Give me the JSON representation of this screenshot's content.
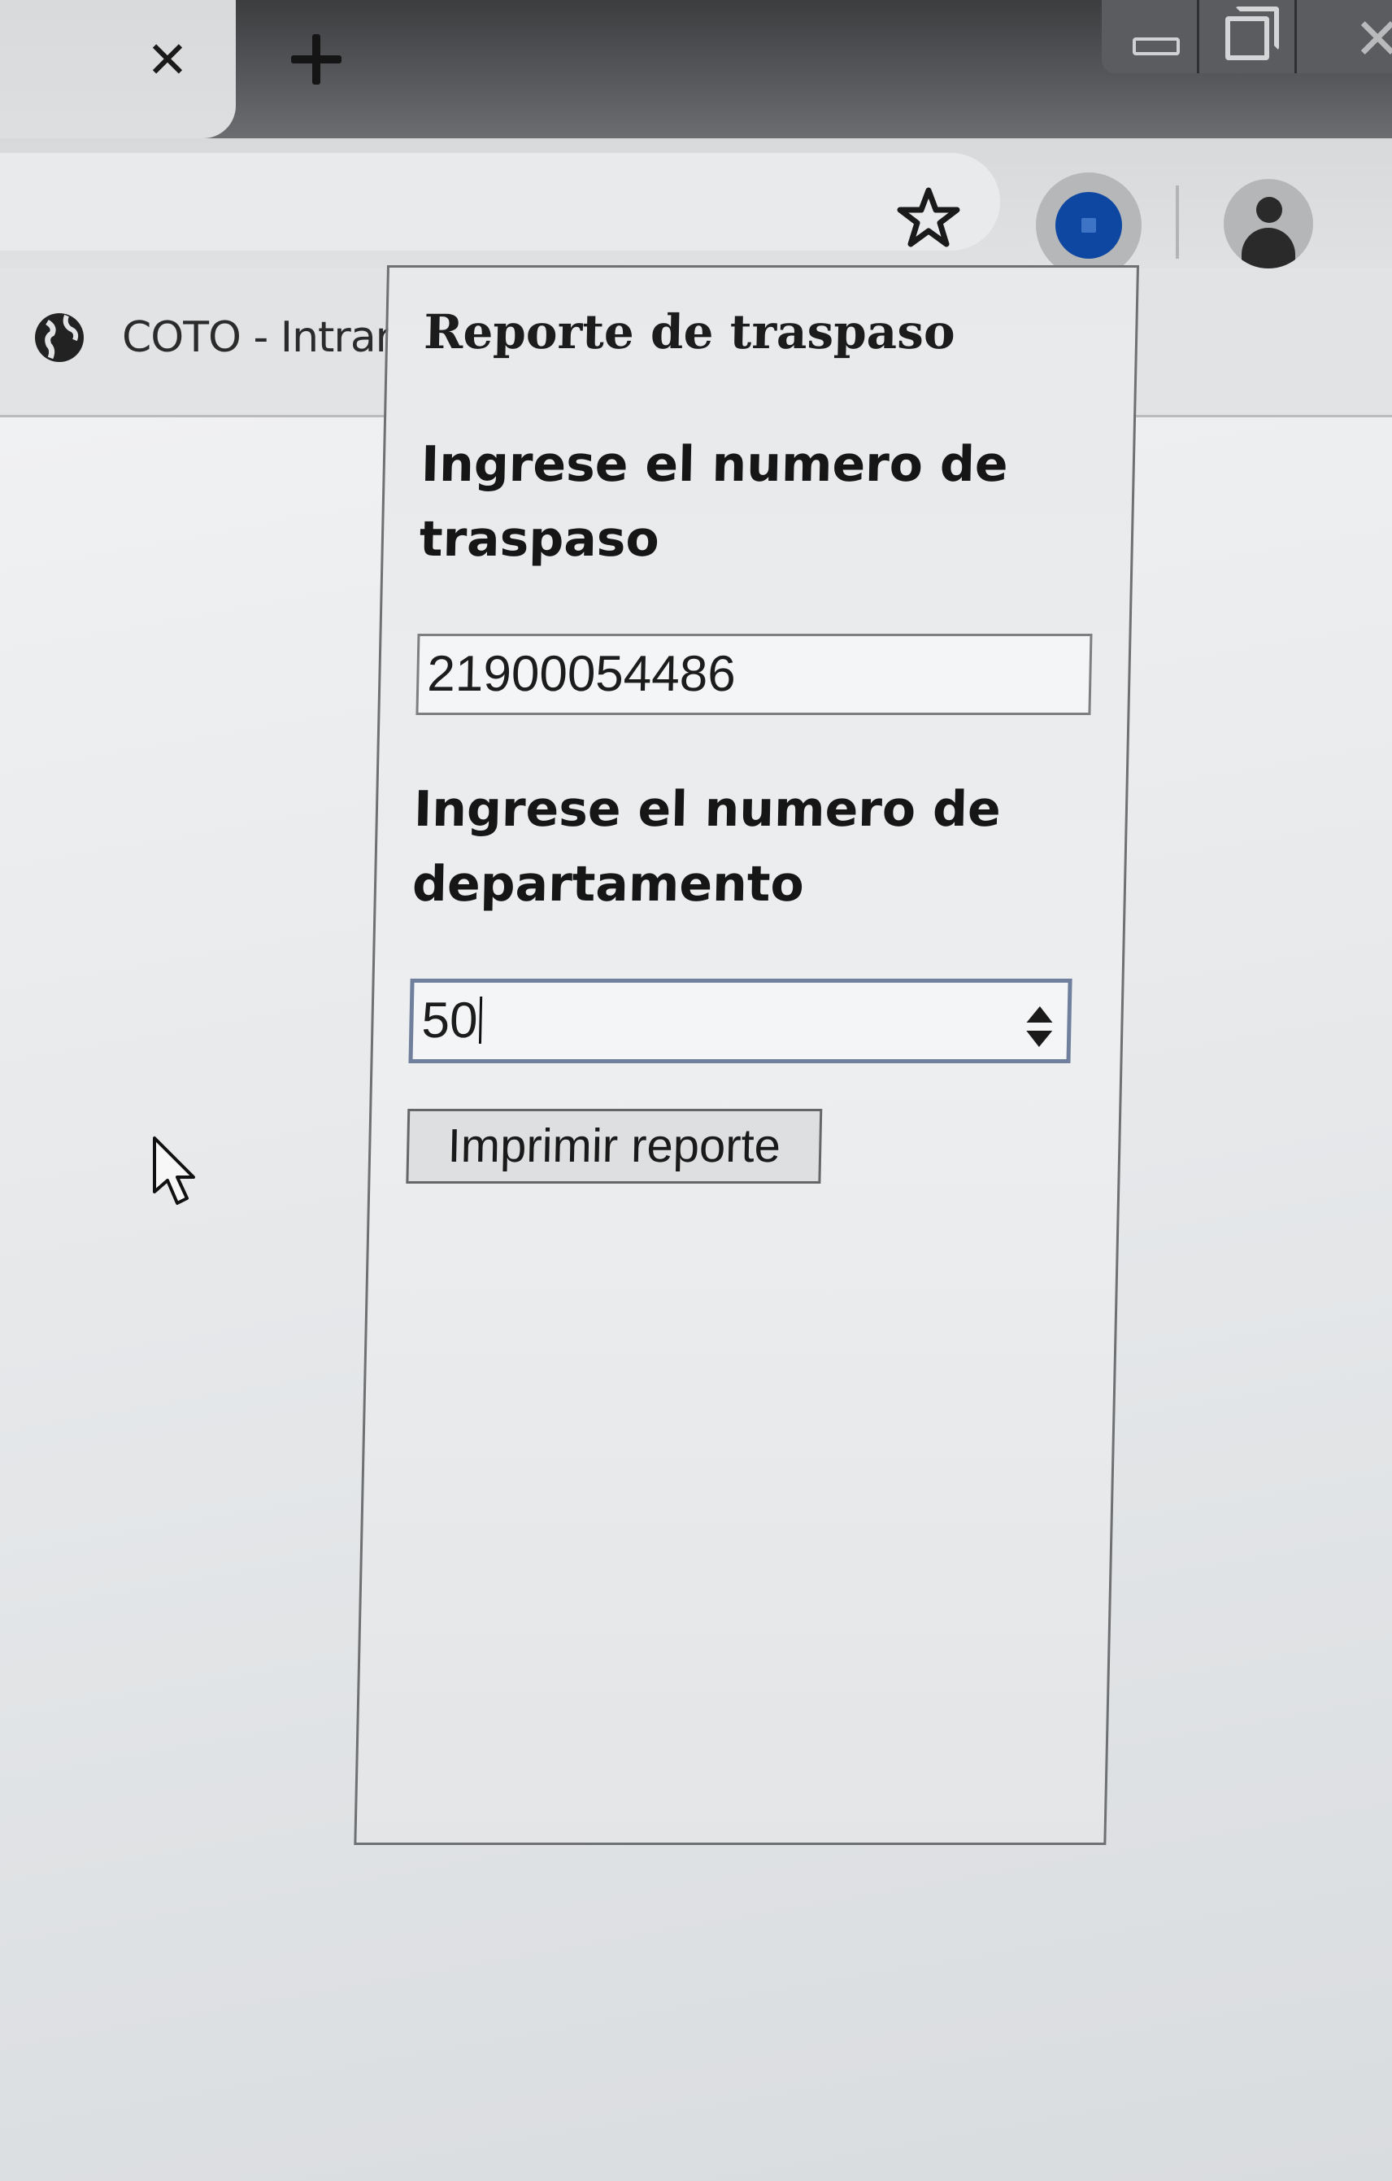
{
  "browser": {
    "new_tab_symbol": "+",
    "icons": [
      "close-icon",
      "new-tab-icon",
      "minimize-icon",
      "restore-icon",
      "window-close-icon",
      "star-icon",
      "extension-icon",
      "profile-icon",
      "globe-icon"
    ]
  },
  "bookmarks": {
    "items": [
      {
        "label": "COTO - Intrar",
        "icon": "globe-icon"
      }
    ]
  },
  "popup": {
    "title": "Reporte de traspaso",
    "traspaso_label": "Ingrese el numero de traspaso",
    "traspaso_value": "21900054486",
    "departamento_label": "Ingrese el numero de departamento",
    "departamento_value": "50",
    "submit_label": "Imprimir reporte"
  },
  "colors": {
    "extension_accent": "#0e47a1",
    "focus_border": "#6f7f9c"
  }
}
